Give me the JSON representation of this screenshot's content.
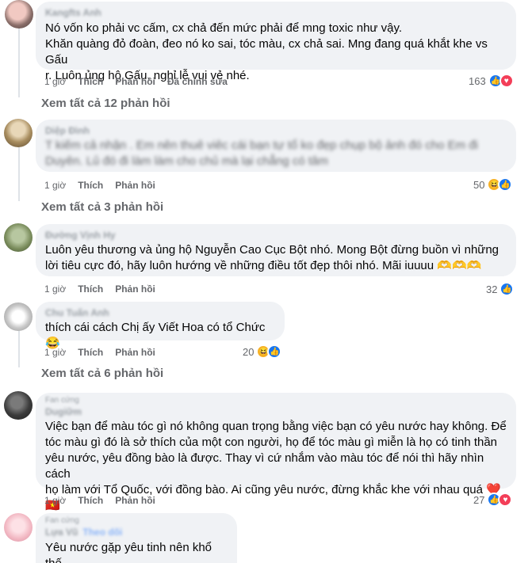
{
  "comments": [
    {
      "author": "Kangfts Anh",
      "text": "Nó vốn ko phải vc cấm, cx chả đến mức phải để mng toxic như vậy.\nKhăn quàng đỏ đoàn, đeo nó ko sai, tóc màu, cx chả sai. Mng đang quá khắt khe vs Gấu\nr. Luôn ủng hộ Gấu, nghỉ lễ vui vẻ nhé.",
      "time": "1 giờ",
      "like": "Thích",
      "reply": "Phản hồi",
      "edited": "Đã chỉnh sửa",
      "reaction_count": "163",
      "reactions": [
        "like-icon",
        "love-icon"
      ],
      "view_replies": "Xem tất cả 12 phản hồi"
    },
    {
      "author": "Diệp Đình",
      "text": "T kiếm cả nhận . Em nên thuê viêc cái bạn tự tổ ko đẹp chụp bộ ảnh đó cho Em đi\nDuyên. Lủ đó đi làm làm cho chủ mà lại chẳng có tâm",
      "time": "1 giờ",
      "like": "Thích",
      "reply": "Phản hồi",
      "reaction_count": "50",
      "reactions": [
        "haha-icon",
        "like-icon"
      ],
      "view_replies": "Xem tất cả 3 phản hồi"
    },
    {
      "author": "Đường Vịnh Hy",
      "text": "Luôn yêu thương và ủng hộ Nguyễn Cao Cục Bột nhó. Mong Bột đừng buồn vì những\nlời tiêu cực đó, hãy luôn hướng về những điều tốt đẹp thôi nhó. Mãi iuuuu 🫶🫶🫶",
      "time": "1 giờ",
      "like": "Thích",
      "reply": "Phản hồi",
      "reaction_count": "32",
      "reactions": [
        "like-icon"
      ]
    },
    {
      "author": "Chu Tuấn Anh",
      "text": "thích cái cách Chị ấy Viết Hoa có tổ Chức 😂",
      "time": "1 giờ",
      "like": "Thích",
      "reply": "Phản hồi",
      "reaction_count": "20",
      "reactions": [
        "haha-icon",
        "like-icon"
      ],
      "view_replies": "Xem tất cả 6 phản hồi"
    },
    {
      "label": "Fan cứng",
      "author": "Dugiữm",
      "text": "Việc bạn để màu tóc gì nó không quan trọng bằng việc bạn có yêu nước hay không. Để\ntóc màu gì đó là sở thích của một con người, họ để tóc màu gì miễn là họ có tinh thần\nyêu nước, yêu đồng bào là được. Thay vì cứ nhắm vào màu tóc để nói thì hãy nhìn cách\nhọ làm với Tổ Quốc, với đồng bào. Ai cũng yêu nước, đừng khắc khe với nhau quá ❤️🇻🇳",
      "time": "1 giờ",
      "like": "Thích",
      "reply": "Phản hồi",
      "reaction_count": "27",
      "reactions": [
        "like-icon",
        "love-icon"
      ]
    },
    {
      "label": "Fan cứng",
      "author": "Lựa Vũ",
      "follow": "Theo dõi",
      "text": "Yêu nước gặp yêu tinh nên khổ thế"
    }
  ],
  "colors": {
    "bubble": "#f0f2f5",
    "like": "#1877f2",
    "love": "#f33e58",
    "haha": "#f7b125",
    "muted": "#65676b"
  }
}
